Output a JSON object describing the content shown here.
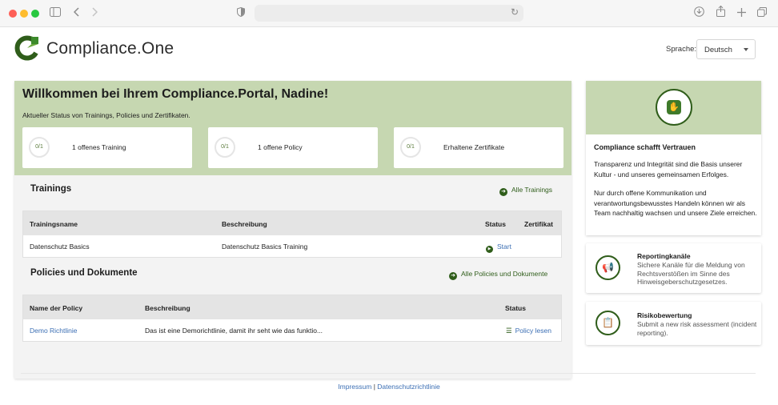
{
  "browser": {
    "dots": [
      "close",
      "minimize",
      "zoom"
    ],
    "icons": [
      "sidebar-icon",
      "back-icon",
      "forward-icon",
      "shield-icon",
      "reload-icon",
      "download-icon",
      "share-icon",
      "new-tab-icon",
      "tabs-icon"
    ]
  },
  "header": {
    "brand": "Compliance.One",
    "language_label": "Sprache:",
    "language_value": "Deutsch"
  },
  "welcome": {
    "title": "Willkommen bei Ihrem Compliance.Portal, Nadine!",
    "subtitle": "Aktueller Status von Trainings, Policies und Zertifikaten.",
    "stats": [
      {
        "progress": "0/1",
        "label": "1 offenes Training"
      },
      {
        "progress": "0/1",
        "label": "1 offene Policy"
      },
      {
        "progress": "0/1",
        "label": "Erhaltene Zertifikate"
      }
    ]
  },
  "trainings": {
    "title": "Trainings",
    "link": "Alle Trainings",
    "headers": [
      "Trainingsname",
      "Beschreibung",
      "Status",
      "Zertifikat"
    ],
    "rows": [
      {
        "name": "Datenschutz Basics",
        "description": "Datenschutz Basics Training",
        "status": "Start"
      }
    ]
  },
  "policies": {
    "title": "Policies und Dokumente",
    "link": "Alle Policies und Dokumente",
    "headers": [
      "Name der Policy",
      "Beschreibung",
      "Status"
    ],
    "rows": [
      {
        "name": "Demo Richtlinie",
        "description": "Das ist eine Demorichtlinie, damit ihr seht wie das funktio...",
        "status": "Policy lesen"
      }
    ]
  },
  "sidebar": {
    "title": "Compliance schafft Vertrauen",
    "paragraph1": "Transparenz und Integrität sind die Basis unserer Kultur - und unseres gemeinsamen Erfolges.",
    "paragraph2": "Nur durch offene Kommunikation und verantwortungsbewusstes Handeln können wir als Team nachhaltig wachsen und unsere Ziele erreichen.",
    "actions": [
      {
        "title": "Reportingkanäle",
        "description": "Sichere Kanäle für die Meldung von Rechtsverstößen im Sinne des Hinweisgeberschutzgesetzes.",
        "icon": "megaphone-icon"
      },
      {
        "title": "Risikobewertung",
        "description": "Submit a new risk assessment (incident reporting).",
        "icon": "clipboard-icon"
      }
    ]
  },
  "footer": {
    "impressum": "Impressum",
    "separator": "|",
    "privacy": "Datenschutzrichtlinie"
  },
  "colors": {
    "accent_green": "#c6d7b1",
    "dark_green": "#2f5d1a",
    "link_blue": "#3c6fb4"
  }
}
